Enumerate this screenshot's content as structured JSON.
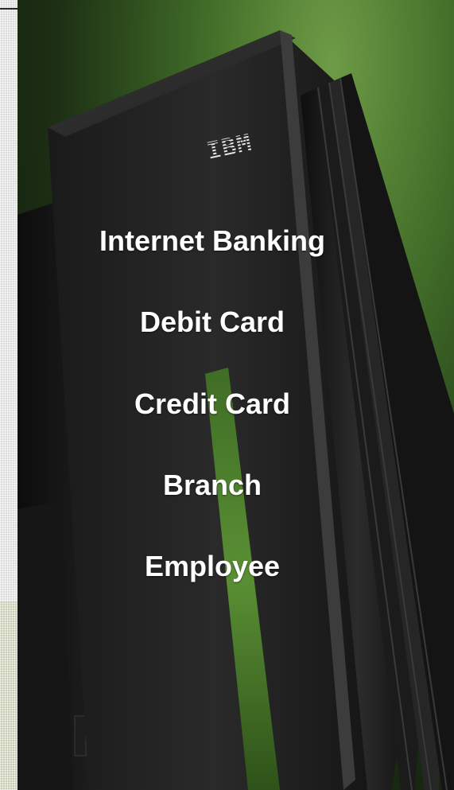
{
  "hero": {
    "brand_logo": "IBM"
  },
  "menu": {
    "items": [
      {
        "label": "Internet Banking"
      },
      {
        "label": "Debit Card"
      },
      {
        "label": "Credit Card"
      },
      {
        "label": "Branch"
      },
      {
        "label": "Employee"
      }
    ]
  },
  "colors": {
    "accent_green": "#4f7a2e",
    "text": "#ffffff",
    "tower_dark": "#1c1c1c"
  }
}
